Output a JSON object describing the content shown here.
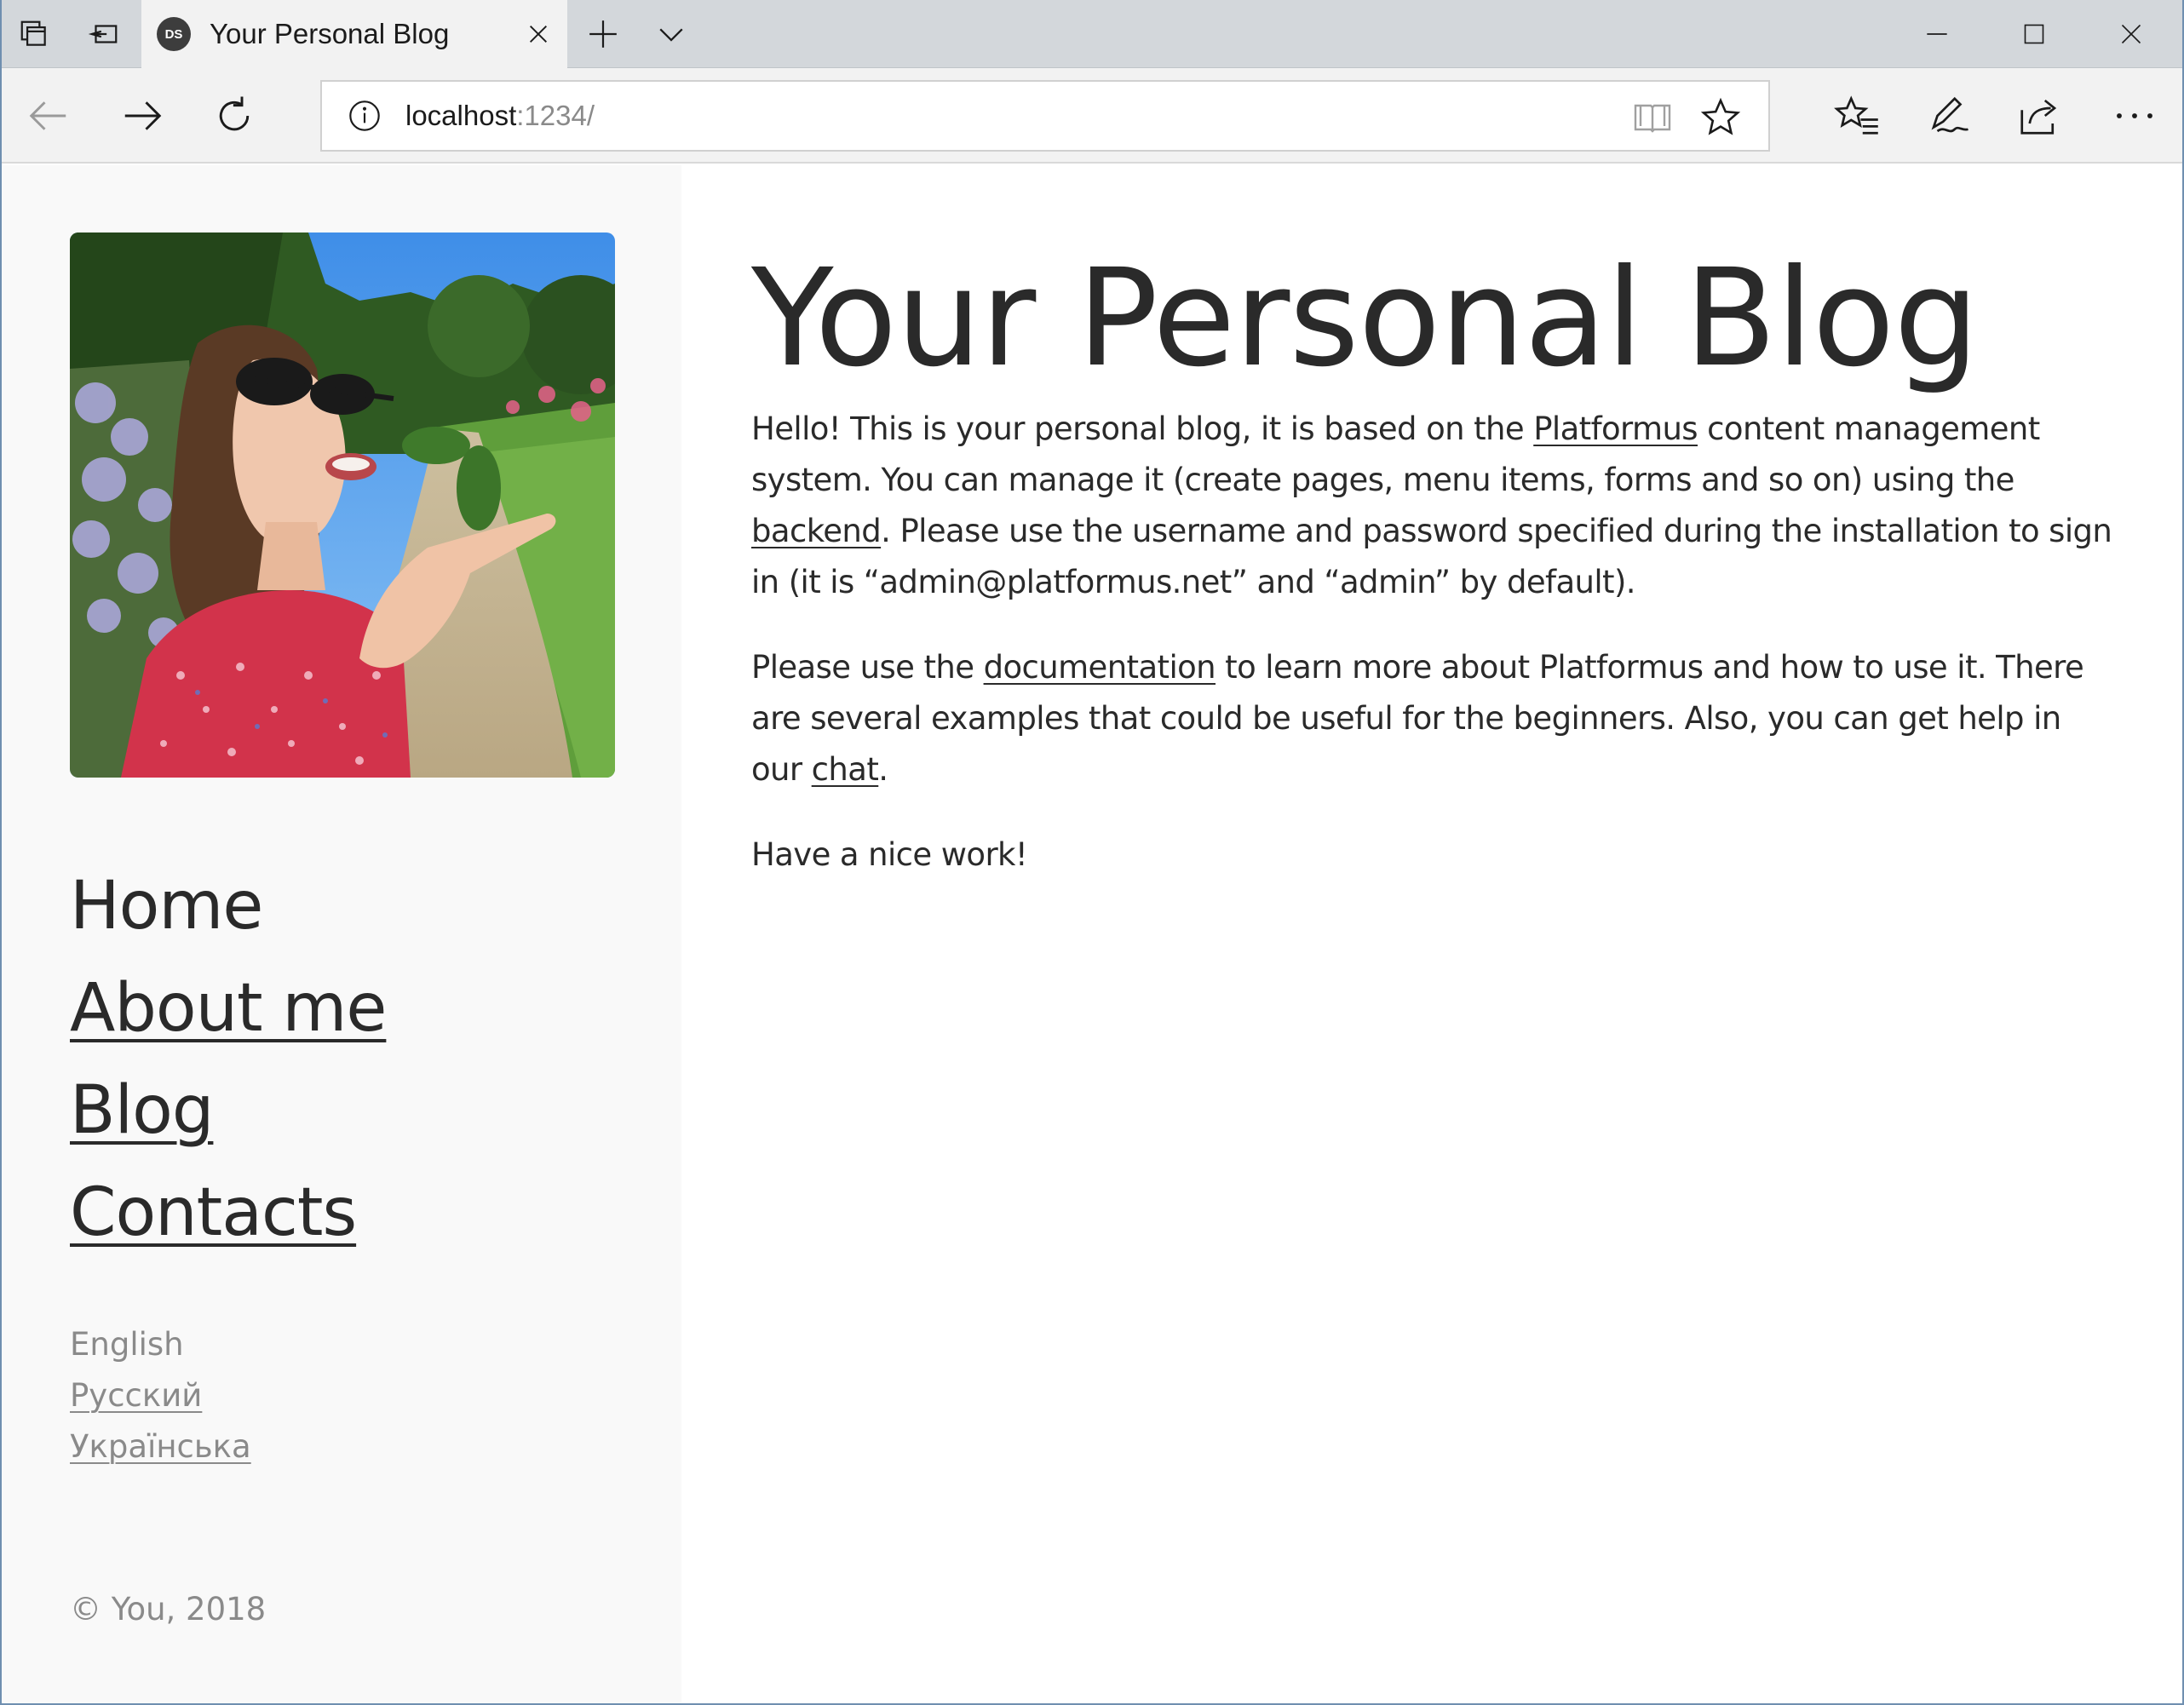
{
  "browser": {
    "tab_title": "Your Personal Blog",
    "tab_favicon_text": "DS",
    "address": {
      "host": "localhost",
      "port": ":1234/"
    }
  },
  "sidebar": {
    "menu": [
      {
        "label": "Home",
        "active": true
      },
      {
        "label": "About me",
        "active": false
      },
      {
        "label": "Blog",
        "active": false
      },
      {
        "label": "Contacts",
        "active": false
      }
    ],
    "languages": [
      {
        "label": "English",
        "active": true
      },
      {
        "label": "Русский",
        "active": false
      },
      {
        "label": "Українська",
        "active": false
      }
    ],
    "copyright": "© You, 2018"
  },
  "main": {
    "title": "Your Personal Blog",
    "p1": {
      "t1": "Hello! This is your personal blog, it is based on the ",
      "link1": "Platformus",
      "t2": " content management system. You can manage it (create pages, menu items, forms and so on) using the ",
      "link2": "backend",
      "t3": ". Please use the username and password specified during the installation to sign in (it is “admin@platformus.net” and “admin” by default)."
    },
    "p2": {
      "t1": "Please use the ",
      "link1": "documentation",
      "t2": " to learn more about Platformus and how to use it. There are several examples that could be useful for the beginners. Also, you can get help in our ",
      "link2": "chat",
      "t3": "."
    },
    "p3": "Have a nice work!"
  },
  "colors": {
    "text": "#2a2a2a",
    "muted": "#8a8a8a",
    "sidebar_bg": "#f9f9f9",
    "tabbar_bg": "#d3d7db",
    "toolbar_bg": "#f2f2f2"
  }
}
